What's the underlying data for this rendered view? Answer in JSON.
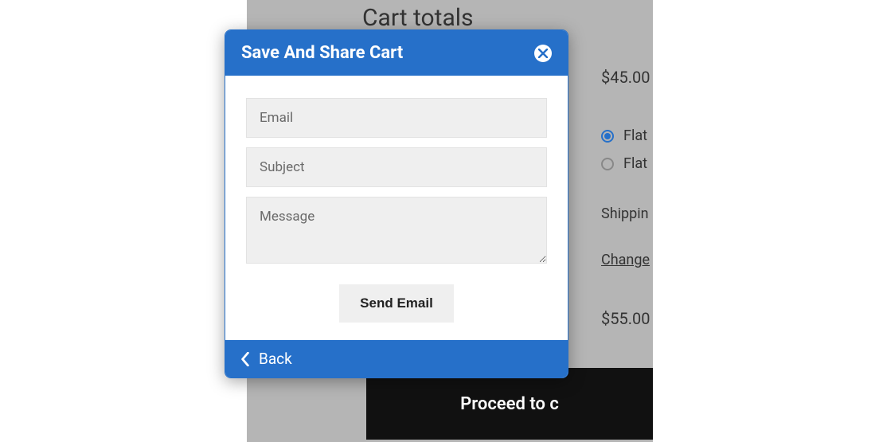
{
  "background": {
    "heading": "Cart totals",
    "subtotal": "$45.00",
    "total": "$55.00",
    "shipping_options": [
      {
        "label": "Flat",
        "checked": true
      },
      {
        "label": "Flat",
        "checked": false
      }
    ],
    "shipping_text": "Shippin",
    "change_link": "Change",
    "checkout_label": "Proceed to c"
  },
  "modal": {
    "title": "Save And Share Cart",
    "email_placeholder": "Email",
    "subject_placeholder": "Subject",
    "message_placeholder": "Message",
    "send_label": "Send Email",
    "back_label": "Back"
  }
}
